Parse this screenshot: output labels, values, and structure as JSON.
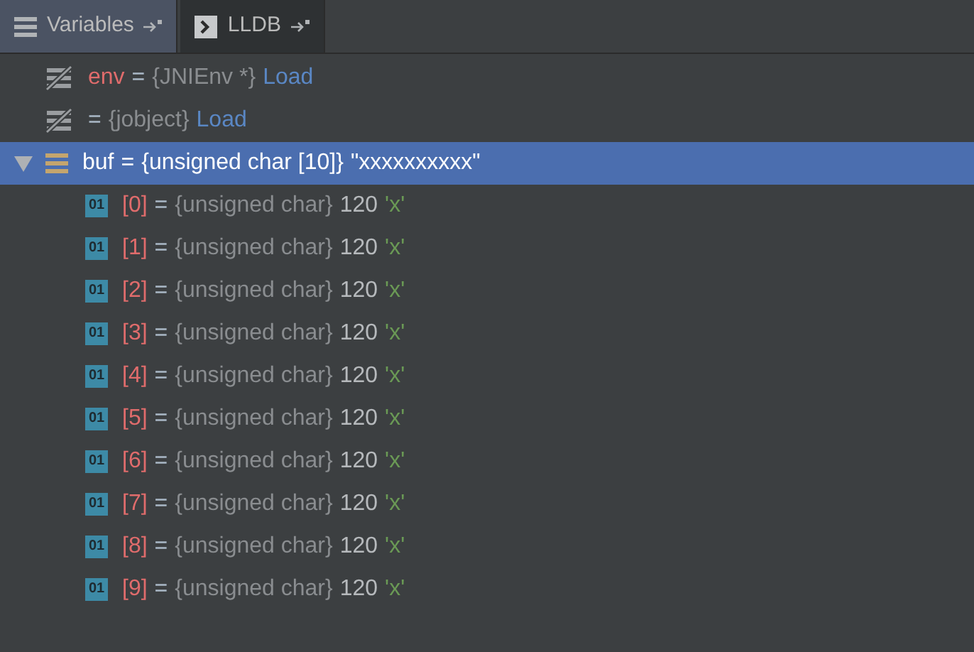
{
  "tabs": [
    {
      "label": "Variables",
      "selected": true
    },
    {
      "label": "LLDB",
      "selected": false
    }
  ],
  "variables": [
    {
      "kind": "unavailable",
      "name": "env",
      "op": "=",
      "type": "{JNIEnv *}",
      "value": "Load",
      "selected": false
    },
    {
      "kind": "unavailable",
      "op": "=",
      "type": "{jobject}",
      "value": "Load",
      "selected": false
    },
    {
      "kind": "array",
      "name": "buf",
      "op": "=",
      "type": "{unsigned char [10]}",
      "value": "\"xxxxxxxxxx\"",
      "selected": true,
      "expanded": true,
      "children": [
        {
          "kind": "primitive",
          "badge": "01",
          "name": "[0]",
          "op": "=",
          "type": "{unsigned char}",
          "value": "120",
          "char": "'x'",
          "selected": false
        },
        {
          "kind": "primitive",
          "badge": "01",
          "name": "[1]",
          "op": "=",
          "type": "{unsigned char}",
          "value": "120",
          "char": "'x'",
          "selected": false
        },
        {
          "kind": "primitive",
          "badge": "01",
          "name": "[2]",
          "op": "=",
          "type": "{unsigned char}",
          "value": "120",
          "char": "'x'",
          "selected": false
        },
        {
          "kind": "primitive",
          "badge": "01",
          "name": "[3]",
          "op": "=",
          "type": "{unsigned char}",
          "value": "120",
          "char": "'x'",
          "selected": false
        },
        {
          "kind": "primitive",
          "badge": "01",
          "name": "[4]",
          "op": "=",
          "type": "{unsigned char}",
          "value": "120",
          "char": "'x'",
          "selected": false
        },
        {
          "kind": "primitive",
          "badge": "01",
          "name": "[5]",
          "op": "=",
          "type": "{unsigned char}",
          "value": "120",
          "char": "'x'",
          "selected": false
        },
        {
          "kind": "primitive",
          "badge": "01",
          "name": "[6]",
          "op": "=",
          "type": "{unsigned char}",
          "value": "120",
          "char": "'x'",
          "selected": false
        },
        {
          "kind": "primitive",
          "badge": "01",
          "name": "[7]",
          "op": "=",
          "type": "{unsigned char}",
          "value": "120",
          "char": "'x'",
          "selected": false
        },
        {
          "kind": "primitive",
          "badge": "01",
          "name": "[8]",
          "op": "=",
          "type": "{unsigned char}",
          "value": "120",
          "char": "'x'",
          "selected": false
        },
        {
          "kind": "primitive",
          "badge": "01",
          "name": "[9]",
          "op": "=",
          "type": "{unsigned char}",
          "value": "120",
          "char": "'x'",
          "selected": false
        }
      ]
    }
  ]
}
